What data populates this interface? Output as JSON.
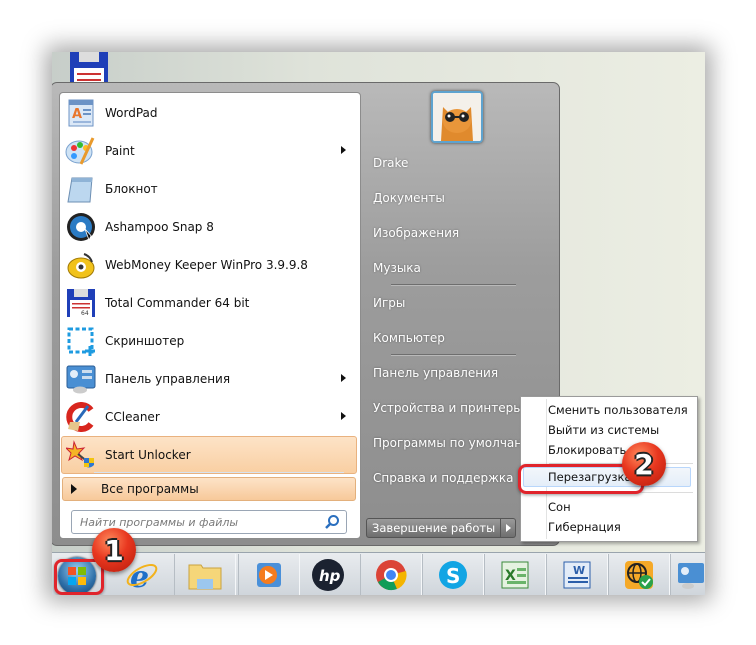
{
  "start_menu": {
    "pinned_programs": [
      {
        "label": "WordPad",
        "icon": "wordpad-icon",
        "has_submenu": false
      },
      {
        "label": "Paint",
        "icon": "paint-icon",
        "has_submenu": true
      },
      {
        "label": "Блокнот",
        "icon": "notepad-icon",
        "has_submenu": false
      },
      {
        "label": "Ashampoo Snap 8",
        "icon": "ashampoo-snap-icon",
        "has_submenu": false
      },
      {
        "label": "WebMoney Keeper WinPro 3.9.9.8",
        "icon": "webmoney-icon",
        "has_submenu": false
      },
      {
        "label": "Total Commander 64 bit",
        "icon": "total-commander-icon",
        "has_submenu": false
      },
      {
        "label": "Скриншотер",
        "icon": "screenshoter-icon",
        "has_submenu": false
      },
      {
        "label": "Панель управления",
        "icon": "control-panel-icon",
        "has_submenu": true
      },
      {
        "label": "CCleaner",
        "icon": "ccleaner-icon",
        "has_submenu": true
      },
      {
        "label": "Start Unlocker",
        "icon": "start-unlocker-icon",
        "has_submenu": false,
        "highlighted": true
      }
    ],
    "all_programs_label": "Все программы",
    "search_placeholder": "Найти программы и файлы",
    "right_items": [
      {
        "label": "Drake"
      },
      {
        "label": "Документы"
      },
      {
        "label": "Изображения"
      },
      {
        "label": "Музыка"
      },
      {
        "label": "Игры"
      },
      {
        "label": "Компьютер"
      },
      {
        "label": "Панель управления"
      },
      {
        "label": "Устройства и принтеры"
      },
      {
        "label": "Программы по умолчанию"
      },
      {
        "label": "Справка и поддержка"
      }
    ],
    "shutdown_label": "Завершение работы"
  },
  "shutdown_menu": {
    "items": [
      {
        "label": "Сменить пользователя"
      },
      {
        "label": "Выйти из системы"
      },
      {
        "label": "Блокировать"
      },
      {
        "label": "Перезагрузка",
        "highlighted": true
      },
      {
        "label": "Сон"
      },
      {
        "label": "Гибернация"
      }
    ]
  },
  "annotations": {
    "step1": "1",
    "step2": "2",
    "accent_color": "#e0242b"
  },
  "taskbar": {
    "items": [
      {
        "name": "start-button"
      },
      {
        "name": "internet-explorer"
      },
      {
        "name": "windows-explorer"
      },
      {
        "name": "media-player"
      },
      {
        "name": "hp"
      },
      {
        "name": "chrome"
      },
      {
        "name": "skype"
      },
      {
        "name": "excel"
      },
      {
        "name": "word"
      },
      {
        "name": "network-app"
      },
      {
        "name": "control-panel"
      }
    ]
  }
}
